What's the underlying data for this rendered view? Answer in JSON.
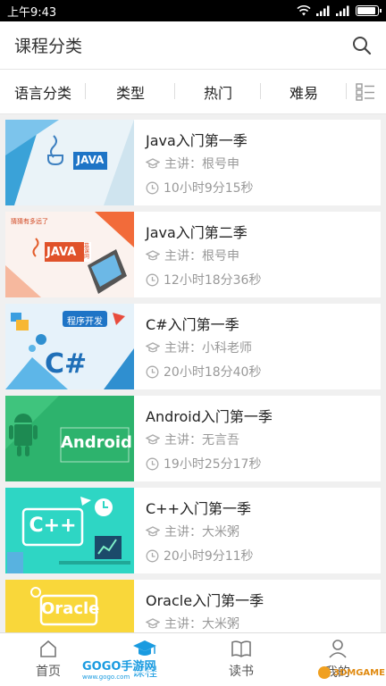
{
  "status": {
    "time": "上午9:43"
  },
  "header": {
    "title": "课程分类"
  },
  "filters": [
    "语言分类",
    "类型",
    "热门",
    "难易"
  ],
  "courses": [
    {
      "title": "Java入门第一季",
      "teacher": "主讲：根号申",
      "duration": "10小时9分15秒",
      "thumb_label": "JAVA"
    },
    {
      "title": "Java入门第二季",
      "teacher": "主讲：根号申",
      "duration": "12小时18分36秒",
      "thumb_label": "JAVA",
      "thumb_tag": "慕课网",
      "thumb_small": "猜猜有多远了"
    },
    {
      "title": "C#入门第一季",
      "teacher": "主讲：小科老师",
      "duration": "20小时18分40秒",
      "thumb_label": "C#",
      "thumb_tag": "程序开发"
    },
    {
      "title": "Android入门第一季",
      "teacher": "主讲：无言吾",
      "duration": "19小时25分17秒",
      "thumb_label": "Android"
    },
    {
      "title": "C++入门第一季",
      "teacher": "主讲：大米粥",
      "duration": "20小时9分11秒",
      "thumb_label": "C++"
    },
    {
      "title": "Oracle入门第一季",
      "teacher": "主讲：大米粥",
      "duration": "",
      "thumb_label": "Oracle"
    }
  ],
  "tabs": [
    {
      "label": "首页",
      "icon": "home-icon"
    },
    {
      "label": "课程",
      "icon": "graduation-cap-icon"
    },
    {
      "label": "读书",
      "icon": "book-icon"
    },
    {
      "label": "我的",
      "icon": "user-icon"
    }
  ],
  "watermarks": {
    "left": "GOGO手游网",
    "left_url": "www.gogo.com",
    "right": "3DMGAME"
  },
  "colors": {
    "accent": "#1a9be0",
    "android_green": "#2db36d",
    "cpp_teal": "#2ed6c4",
    "oracle_yellow": "#f9d73a"
  }
}
